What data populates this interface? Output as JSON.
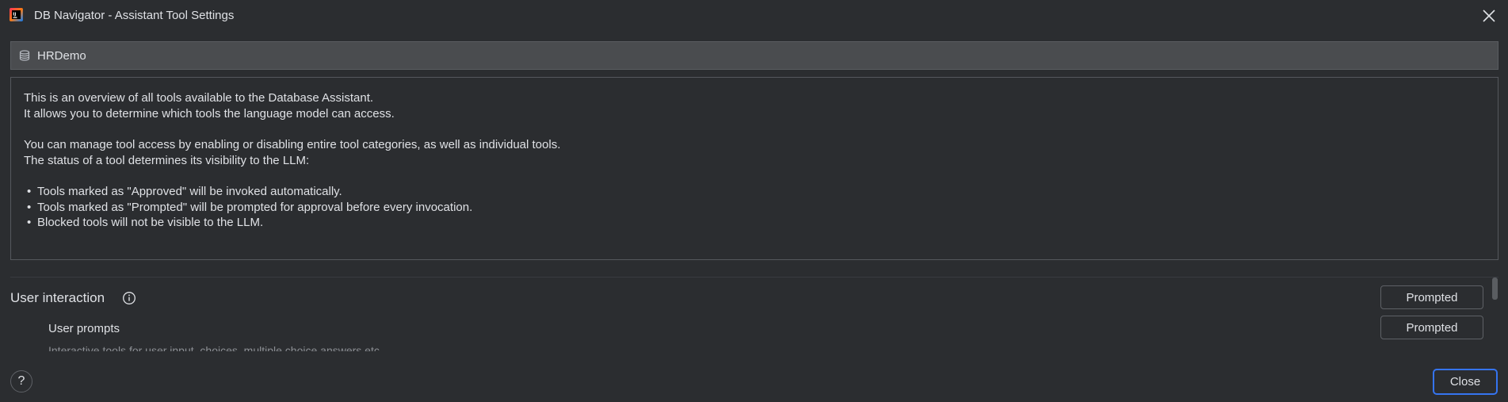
{
  "window": {
    "title": "DB Navigator - Assistant Tool Settings",
    "app_icon": "intellij-icon",
    "close_icon": "close-icon"
  },
  "connection": {
    "icon": "database-icon",
    "name": "HRDemo"
  },
  "description": {
    "line1": "This is an overview of all tools available to the Database Assistant.",
    "line2": "It allows you to determine which tools the language model can access.",
    "line3": "You can manage tool access by enabling or disabling entire tool categories, as well as individual tools.",
    "line4": "The status of a tool determines its visibility to the LLM:",
    "bullets": [
      "Tools marked as \"Approved\" will be invoked automatically.",
      "Tools marked as \"Prompted\" will be prompted for approval before every invocation.",
      "Blocked tools will not be visible to the LLM."
    ]
  },
  "category": {
    "label": "User interaction",
    "info_icon": "info-icon",
    "status": "Prompted",
    "tools": [
      {
        "label": "User prompts",
        "description": "Interactive tools for user input, choices, multiple choice answers etc.",
        "status": "Prompted"
      }
    ]
  },
  "footer": {
    "help_label": "?",
    "close_label": "Close"
  },
  "colors": {
    "background": "#2b2d30",
    "header_bar": "#4a4c4f",
    "accent": "#3574f0",
    "text": "#dfe1e5"
  }
}
